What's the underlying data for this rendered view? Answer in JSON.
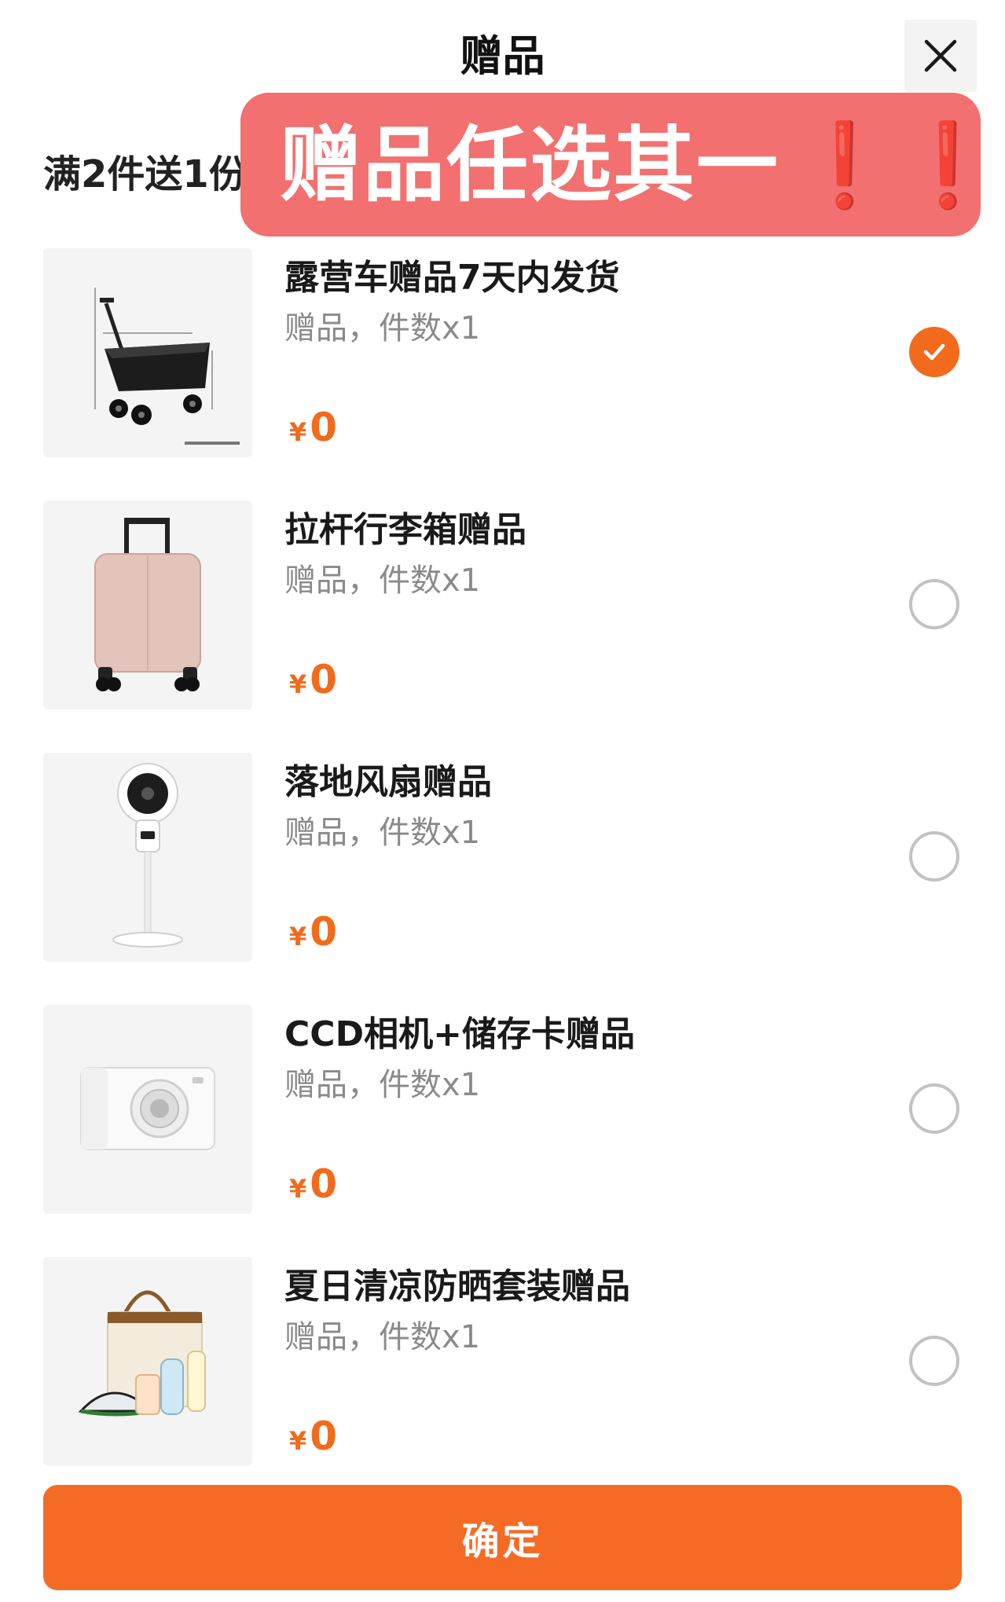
{
  "header": {
    "title": "赠品",
    "subtitle": "满2件送1份礼",
    "close_icon": "close-icon"
  },
  "banner": {
    "text": "赠品任选其一",
    "exclamation": "❗❗"
  },
  "gifts": [
    {
      "name": "露营车赠品7天内发货",
      "meta": "赠品，件数x1",
      "currency": "¥",
      "price": "0",
      "selected": true,
      "image": "camping-cart-image"
    },
    {
      "name": "拉杆行李箱赠品",
      "meta": "赠品，件数x1",
      "currency": "¥",
      "price": "0",
      "selected": false,
      "image": "luggage-image"
    },
    {
      "name": "落地风扇赠品",
      "meta": "赠品，件数x1",
      "currency": "¥",
      "price": "0",
      "selected": false,
      "image": "floor-fan-image"
    },
    {
      "name": "CCD相机+储存卡赠品",
      "meta": "赠品，件数x1",
      "currency": "¥",
      "price": "0",
      "selected": false,
      "image": "camera-image"
    },
    {
      "name": "夏日清凉防晒套装赠品",
      "meta": "赠品，件数x1",
      "currency": "¥",
      "price": "0",
      "selected": false,
      "image": "sun-protection-kit-image"
    }
  ],
  "footer": {
    "confirm_label": "确定"
  },
  "colors": {
    "accent": "#f56b25",
    "price": "#f26a1b",
    "banner": "#f2706f"
  }
}
